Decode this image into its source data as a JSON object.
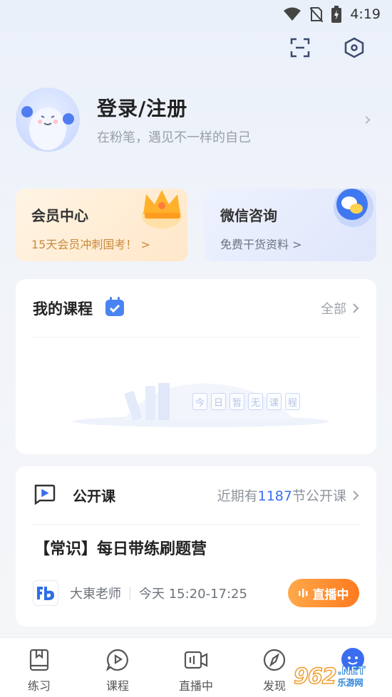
{
  "status_bar": {
    "time": "4:19"
  },
  "top_actions": {
    "scan_icon": "scan-icon",
    "settings_icon": "hexagon-settings-icon"
  },
  "profile": {
    "title": "登录/注册",
    "subtitle": "在粉笔，遇见不一样的自己",
    "chevron": "›"
  },
  "promos": {
    "vip": {
      "title": "会员中心",
      "subtitle": "15天会员冲刺国考！ >"
    },
    "wechat": {
      "title": "微信咨询",
      "subtitle": "免费干货资料 >"
    }
  },
  "my_courses": {
    "title": "我的课程",
    "link": "全部",
    "empty_chars": [
      "今",
      "日",
      "暂",
      "无",
      "课",
      "程"
    ]
  },
  "open_class": {
    "title": "公开课",
    "count_prefix": "近期有",
    "count": "1187",
    "count_suffix": "节公开课",
    "lesson_title": "【常识】每日带练刷题营",
    "teacher": "大東老师",
    "time": "今天 15:20-17:25",
    "live_label": "直播中"
  },
  "tabs": [
    {
      "label": "练习",
      "icon": "practice-book-icon"
    },
    {
      "label": "课程",
      "icon": "course-play-icon"
    },
    {
      "label": "直播中",
      "icon": "live-camera-icon"
    },
    {
      "label": "发现",
      "icon": "discover-compass-icon"
    },
    {
      "label": "",
      "icon": "me-face-icon"
    }
  ],
  "watermark": {
    "number": "962",
    "net": ".NET",
    "site": "乐游网"
  },
  "colors": {
    "accent": "#3a6df0",
    "live_orange": "#ff8a2a",
    "vip_bg": "#ffeccd",
    "wechat_bg": "#e6ebfc"
  }
}
